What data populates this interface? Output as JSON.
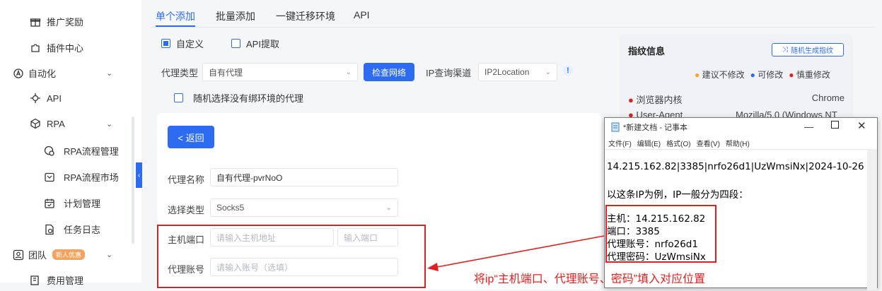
{
  "sidebar": {
    "items": [
      {
        "label": "推广奖励",
        "icon": "gift-icon"
      },
      {
        "label": "插件中心",
        "icon": "puzzle-icon"
      },
      {
        "label": "自动化",
        "icon": "automation-icon"
      },
      {
        "label": "API",
        "icon": "api-icon"
      },
      {
        "label": "RPA",
        "icon": "rpa-icon"
      },
      {
        "label": "RPA流程管理",
        "icon": "process-manage-icon"
      },
      {
        "label": "RPA流程市场",
        "icon": "market-icon"
      },
      {
        "label": "计划管理",
        "icon": "calendar-icon"
      },
      {
        "label": "任务日志",
        "icon": "log-icon"
      },
      {
        "label": "团队",
        "icon": "team-icon",
        "badge": "新人优惠"
      },
      {
        "label": "费用管理",
        "icon": "fee-icon"
      }
    ]
  },
  "tabs": [
    "单个添加",
    "批量添加",
    "一键迁移环境",
    "API"
  ],
  "mode": {
    "custom": "自定义",
    "api_extract": "API提取"
  },
  "proxy": {
    "type_label": "代理类型",
    "type_value": "自有代理",
    "check_button": "检查网络",
    "ip_channel_label": "IP查询渠道",
    "ip_channel_value": "IP2Location",
    "info_icon": "!",
    "random_label": "随机选择没有绑环境的代理"
  },
  "form": {
    "back_button": "< 返回",
    "name_label": "代理名称",
    "name_value": "自有代理-pvrNoO",
    "select_type_label": "选择类型",
    "select_type_value": "Socks5",
    "host_port_label": "主机端口",
    "host_placeholder": "请输入主机地址",
    "port_placeholder": "输入端口",
    "account_label": "代理账号",
    "account_placeholder": "请输入账号（选填）"
  },
  "fingerprint": {
    "title": "指纹信息",
    "random_button": "随机生成指纹",
    "legend": [
      "建议不修改",
      "可修改",
      "慎重修改"
    ],
    "legend_colors": [
      "#f5a623",
      "#2d6cf0",
      "#e02020"
    ],
    "rows": [
      {
        "label": "浏览器内核",
        "value": "Chrome"
      },
      {
        "label": "User-Agent",
        "value": "Mozilla/5.0 (Windows NT"
      }
    ]
  },
  "notepad": {
    "title": "*新建文档 - 记事本",
    "menu": [
      "文件(F)",
      "编辑(E)",
      "格式(O)",
      "查看(V)",
      "帮助(H)"
    ],
    "lines": [
      "14.215.162.82|3385|nrfo26d1|UzWmsiNx|2024-10-26",
      "以这条IP为例，IP一般分为四段：",
      "主机：14.215.162.82",
      "端口：3385",
      "代理账号：nrfo26d1",
      "代理密码：UzWmsiNx"
    ]
  },
  "annotation": "将ip“主机端口、代理账号、密码”填入对应位置",
  "colors": {
    "accent": "#2d6cf0",
    "annotation_red": "#e02020"
  }
}
